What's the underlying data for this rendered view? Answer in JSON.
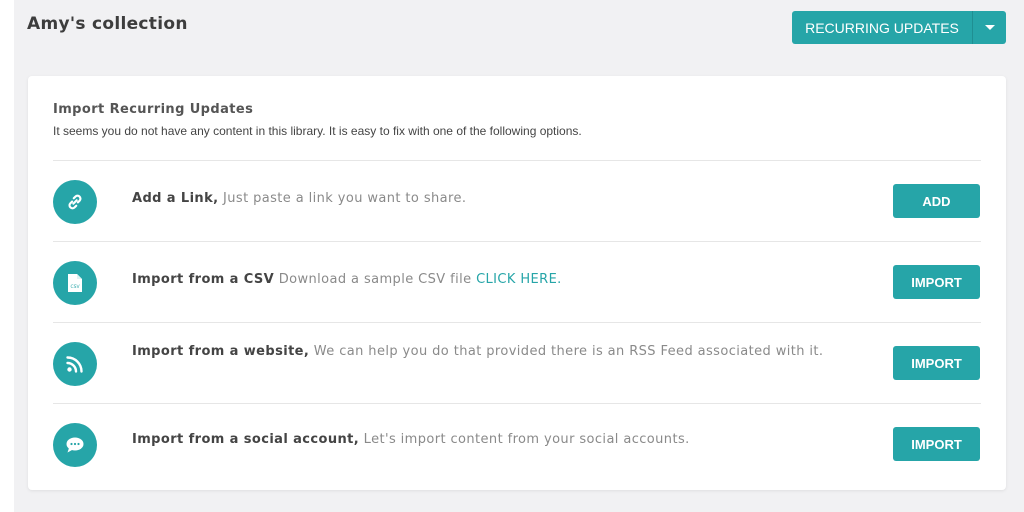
{
  "header": {
    "title": "Amy's collection",
    "recurring_label": "RECURRING UPDATES"
  },
  "card": {
    "title": "Import Recurring Updates",
    "subtitle": "It seems you do not have any content in this library. It is easy to fix with one of the following options."
  },
  "options": [
    {
      "icon": "link-icon",
      "title": "Add a Link,",
      "desc": "Just paste a link you want to share.",
      "button": "ADD"
    },
    {
      "icon": "csv-file-icon",
      "icon_text": "CSV",
      "title": "Import from a CSV",
      "desc": "Download a sample CSV file",
      "link": "CLICK HERE.",
      "button": "IMPORT"
    },
    {
      "icon": "rss-icon",
      "title": "Import from a website,",
      "desc": "We can help you do that provided there is an RSS Feed associated with it.",
      "button": "IMPORT"
    },
    {
      "icon": "chat-bubble-icon",
      "title": "Import from a social account,",
      "desc": "Let's import content from your social accounts.",
      "button": "IMPORT"
    }
  ],
  "colors": {
    "accent": "#26a5a8",
    "page_background": "#f1f1f3",
    "card_background": "#ffffff"
  }
}
